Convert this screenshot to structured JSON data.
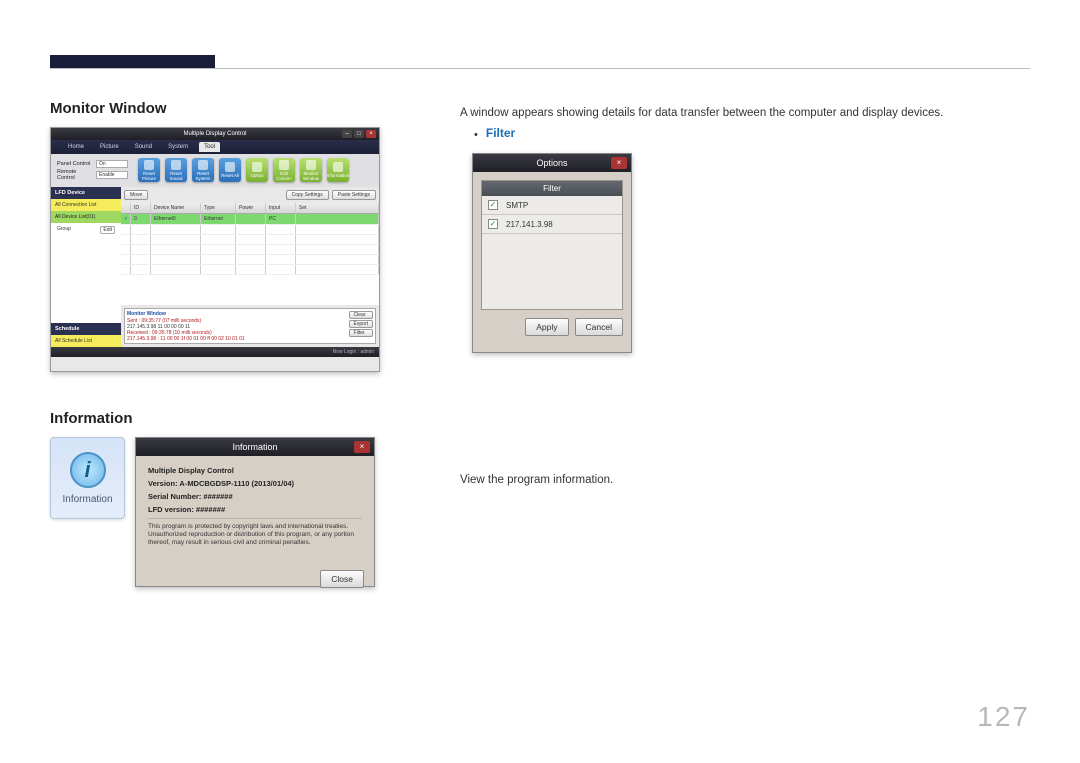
{
  "page_number": "127",
  "section1": {
    "title": "Monitor Window",
    "desc": "A window appears showing details for data transfer between the computer and display devices.",
    "filter_label": "Filter"
  },
  "app": {
    "title": "Multiple Display Control",
    "tabs": [
      "Home",
      "Picture",
      "Sound",
      "System",
      "Tool"
    ],
    "panel_control_label": "Panel Control",
    "panel_control_value": "On",
    "remote_control_label": "Remote Control",
    "remote_control_value": "Enable",
    "icons": [
      "Reset Picture",
      "Reset Sound",
      "Reset System",
      "Reset All",
      "Option",
      "Edit Column",
      "Monitor Window",
      "Information"
    ],
    "side_hdr1": "LFD Device",
    "side_item1": "All Connection List",
    "side_item2": "All Device List(01)",
    "side_sub": "Group",
    "side_sub_btn": "Edit",
    "side_hdr2": "Schedule",
    "side_item3": "All Schedule List",
    "btn_move": "Move",
    "btn_copy": "Copy Settings",
    "btn_paste": "Paste Settings",
    "cols": {
      "id": "ID",
      "name": "Device Name",
      "type": "Type",
      "power": "Power",
      "input": "Input",
      "set": "Set"
    },
    "row": {
      "id": "0",
      "name": "Ethernet0",
      "type": "Ethernet",
      "power": "",
      "input": "PC",
      "set": ""
    },
    "log_title": "Monitor Window",
    "log_sent": "Sent : 09:35:77 (07 milli seconds)",
    "log_ip": "217.145.3.98 11 00 00 00 11",
    "log_recv": "Received : 09:35:78 (10 milli seconds)",
    "log_recv2": "217.145.3.98 : 11 00 00 1f 00 01 00 ff 00 02 10 01 01",
    "log_btn_clear": "Clear",
    "log_btn_export": "Export",
    "log_btn_filter": "Filter",
    "footer": "Now Login : admin"
  },
  "filter_dlg": {
    "title": "Options",
    "header": "Filter",
    "rows": [
      "SMTP",
      "217.141.3.98"
    ],
    "apply": "Apply",
    "cancel": "Cancel"
  },
  "section2": {
    "title": "Information",
    "desc": "View the program information.",
    "tile_label": "Information"
  },
  "info_dlg": {
    "title": "Information",
    "l1": "Multiple Display Control",
    "l2": "Version: A-MDCBGDSP-1110 (2013/01/04)",
    "l3": "Serial Number: #######",
    "l4": "LFD version: #######",
    "disc": "This program is protected by copyright laws and international treaties. Unauthorized reproduction or distribution of this program, or any portion thereof, may result in serious civil and criminal penalties.",
    "close": "Close"
  }
}
